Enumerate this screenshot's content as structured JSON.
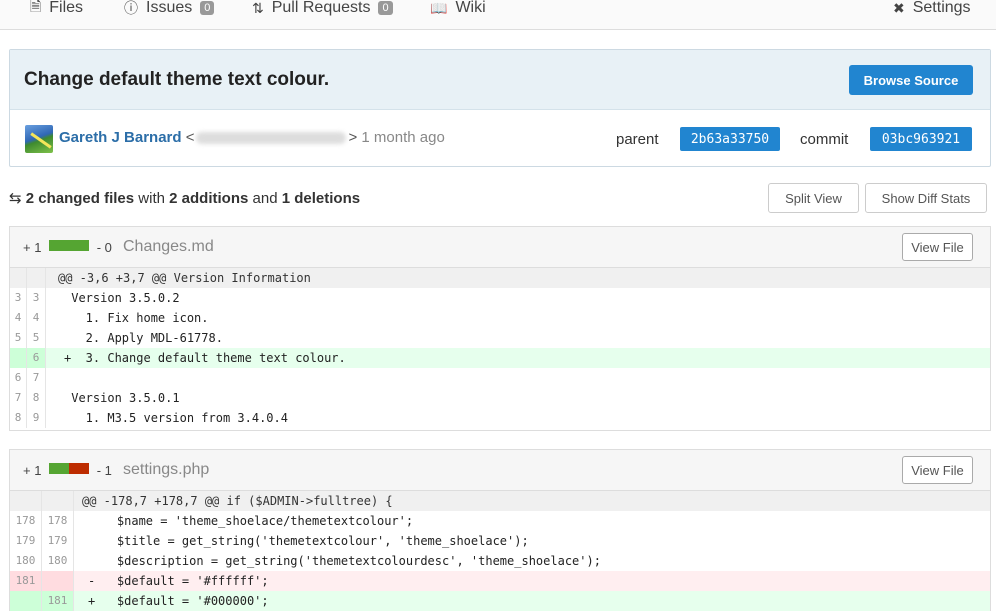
{
  "tabs": [
    {
      "label": "Files",
      "icon": "file-icon"
    },
    {
      "label": "Issues",
      "icon": "issue-icon",
      "count": "0"
    },
    {
      "label": "Pull Requests",
      "icon": "pull-request-icon",
      "count": "0"
    },
    {
      "label": "Wiki",
      "icon": "book-icon"
    }
  ],
  "settings_label": "Settings",
  "commit": {
    "title": "Change default theme text colour.",
    "browse_label": "Browse Source",
    "author": "Gareth J Barnard",
    "time_ago": "1 month ago",
    "parent_label": "parent",
    "parent_sha": "2b63a33750",
    "commit_label": "commit",
    "commit_sha": "03bc963921"
  },
  "stats": {
    "files": "2 changed files",
    "with": "with",
    "additions": "2 additions",
    "and": "and",
    "deletions": "1 deletions",
    "split_label": "Split View",
    "diffstats_label": "Show Diff Stats"
  },
  "files": [
    {
      "plus": "+ 1",
      "minus": "- 0",
      "name": "Changes.md",
      "view_label": "View File",
      "hunk": "@@ -3,6 +3,7 @@ Version Information",
      "lines": [
        {
          "old": "3",
          "new": "3",
          "type": "ctx",
          "text": " Version 3.5.0.2"
        },
        {
          "old": "4",
          "new": "4",
          "type": "ctx",
          "text": "   1. Fix home icon."
        },
        {
          "old": "5",
          "new": "5",
          "type": "ctx",
          "text": "   2. Apply MDL-61778."
        },
        {
          "old": "",
          "new": "6",
          "type": "add",
          "text": "+  3. Change default theme text colour."
        },
        {
          "old": "6",
          "new": "7",
          "type": "ctx",
          "text": ""
        },
        {
          "old": "7",
          "new": "8",
          "type": "ctx",
          "text": " Version 3.5.0.1"
        },
        {
          "old": "8",
          "new": "9",
          "type": "ctx",
          "text": "   1. M3.5 version from 3.4.0.4"
        }
      ]
    },
    {
      "plus": "+ 1",
      "minus": "- 1",
      "name": "settings.php",
      "view_label": "View File",
      "hunk": "@@ -178,7 +178,7 @@ if ($ADMIN->fulltree) {",
      "lines": [
        {
          "old": "178",
          "new": "178",
          "type": "ctx",
          "text": "    $name = 'theme_shoelace/themetextcolour';"
        },
        {
          "old": "179",
          "new": "179",
          "type": "ctx",
          "text": "    $title = get_string('themetextcolour', 'theme_shoelace');"
        },
        {
          "old": "180",
          "new": "180",
          "type": "ctx",
          "text": "    $description = get_string('themetextcolourdesc', 'theme_shoelace');"
        },
        {
          "old": "181",
          "new": "",
          "type": "del",
          "text": "-   $default = '#ffffff';"
        },
        {
          "old": "",
          "new": "181",
          "type": "add",
          "text": "+   $default = '#000000';"
        }
      ]
    }
  ],
  "colors": {
    "accent": "#2185d0",
    "add_bar": "#55a532",
    "del_bar": "#bd2c00"
  }
}
